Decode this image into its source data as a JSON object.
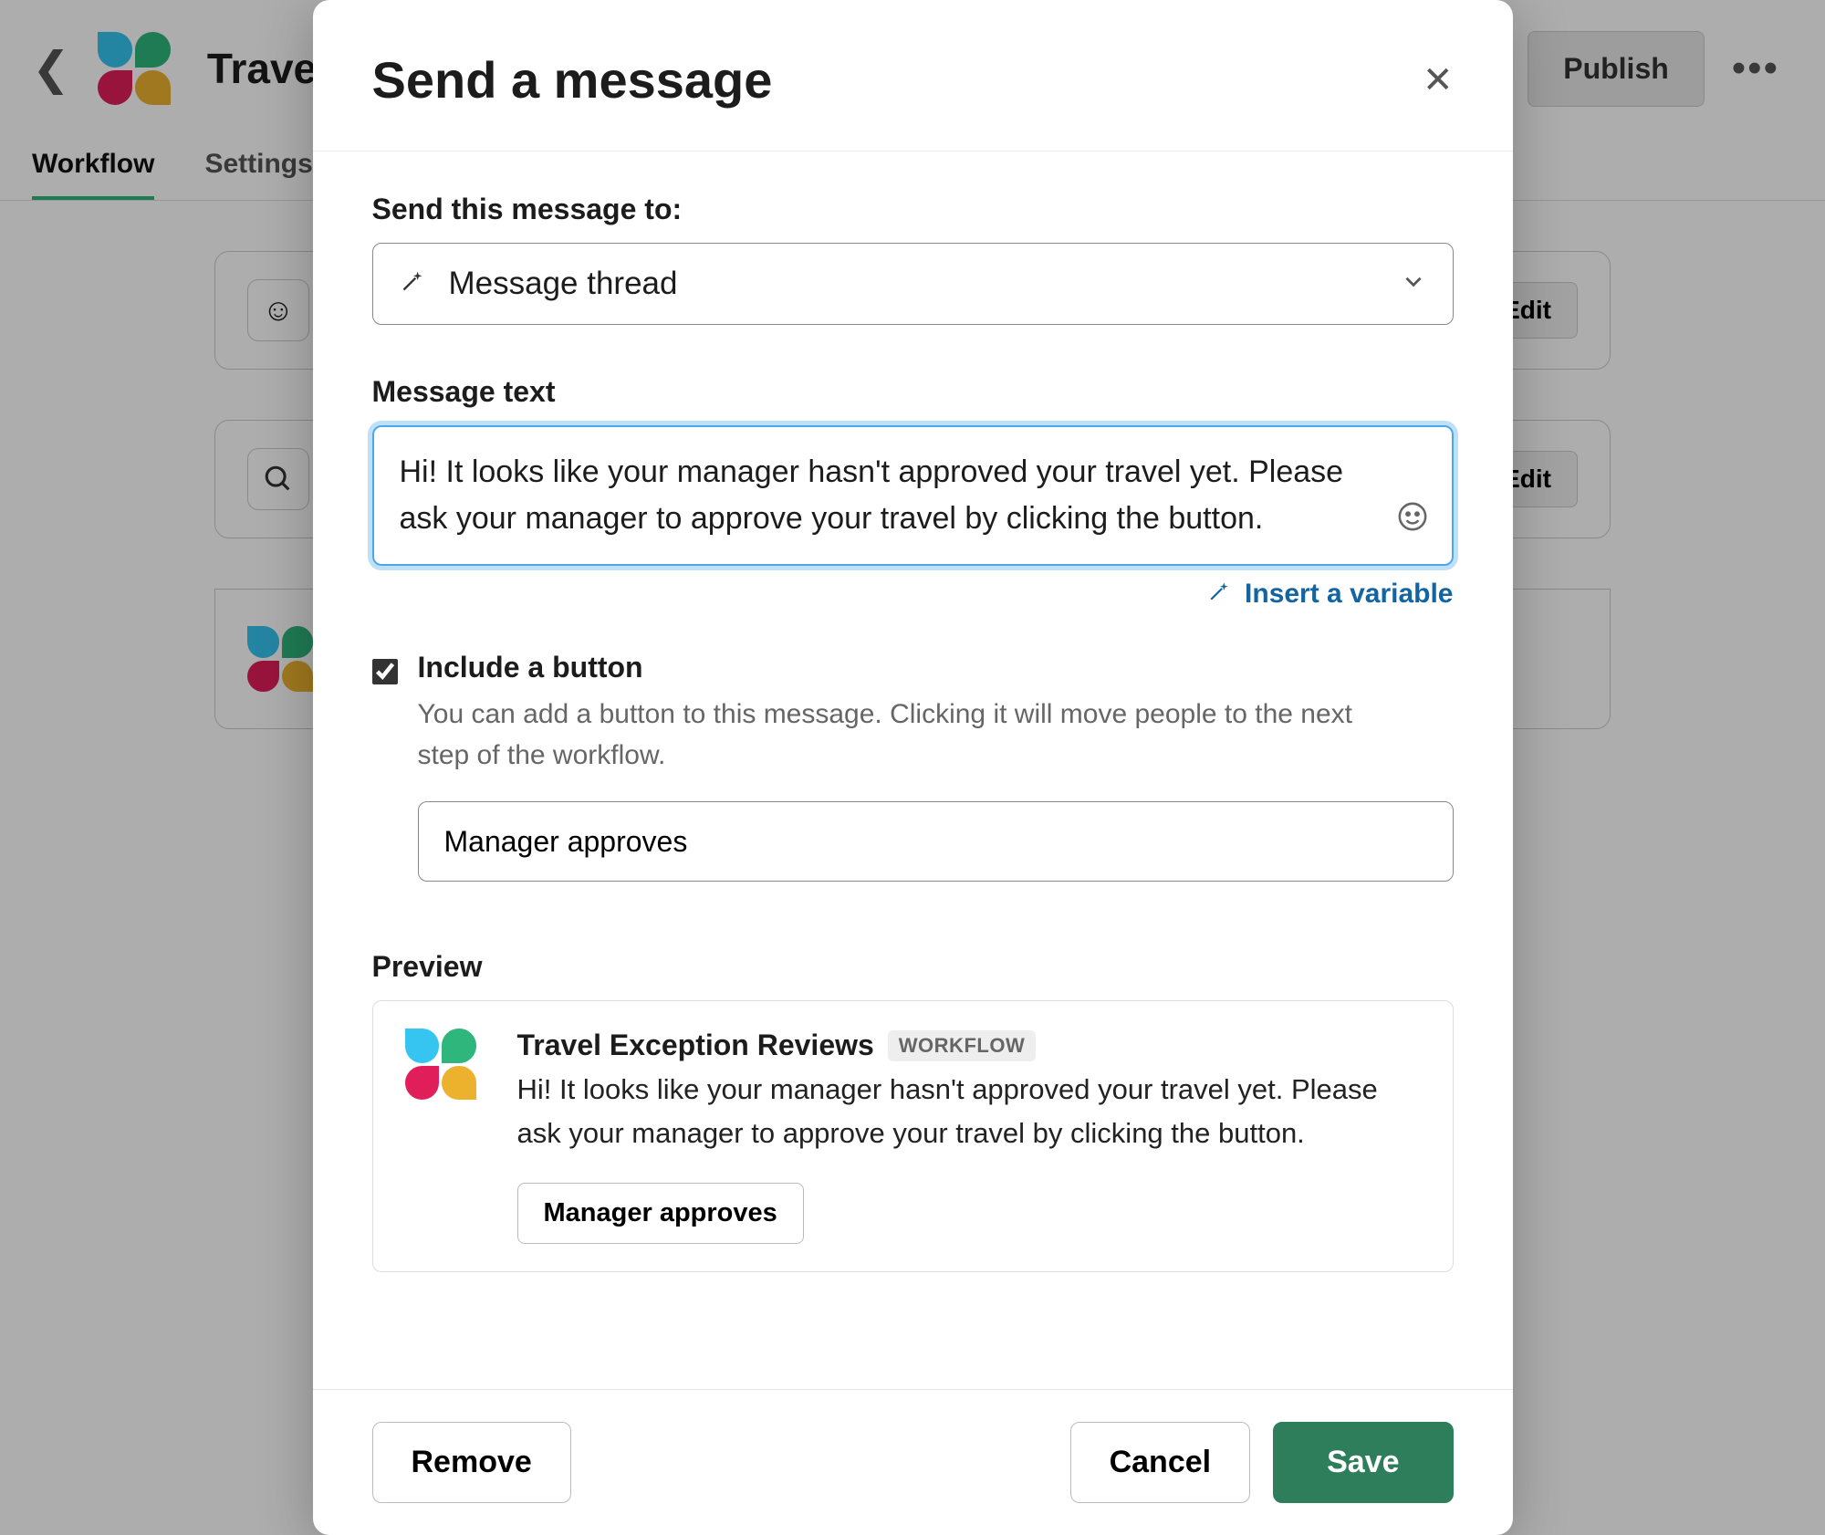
{
  "header": {
    "title": "Travel",
    "publish": "Publish"
  },
  "tabs": {
    "workflow": "Workflow",
    "settings": "Settings"
  },
  "steps": {
    "edit_label": "Edit"
  },
  "modal": {
    "title": "Send a message",
    "send_to_label": "Send this message to:",
    "send_to_value": "Message thread",
    "message_label": "Message text",
    "message_text": "Hi! It looks like your manager hasn't approved your travel yet. Please ask your manager to approve your travel by clicking the button.",
    "insert_variable": "Insert a variable",
    "include_button_title": "Include a button",
    "include_button_desc": "You can add a button to this message. Clicking it will move people to the next step of the workflow.",
    "button_label_value": "Manager approves",
    "preview_label": "Preview",
    "preview": {
      "app_name": "Travel Exception Reviews",
      "badge": "WORKFLOW",
      "body": "Hi! It looks like your manager hasn't approved your travel yet. Please ask your manager to approve your travel by clicking the button.",
      "button_label": "Manager approves"
    },
    "footer": {
      "remove": "Remove",
      "cancel": "Cancel",
      "save": "Save"
    }
  }
}
